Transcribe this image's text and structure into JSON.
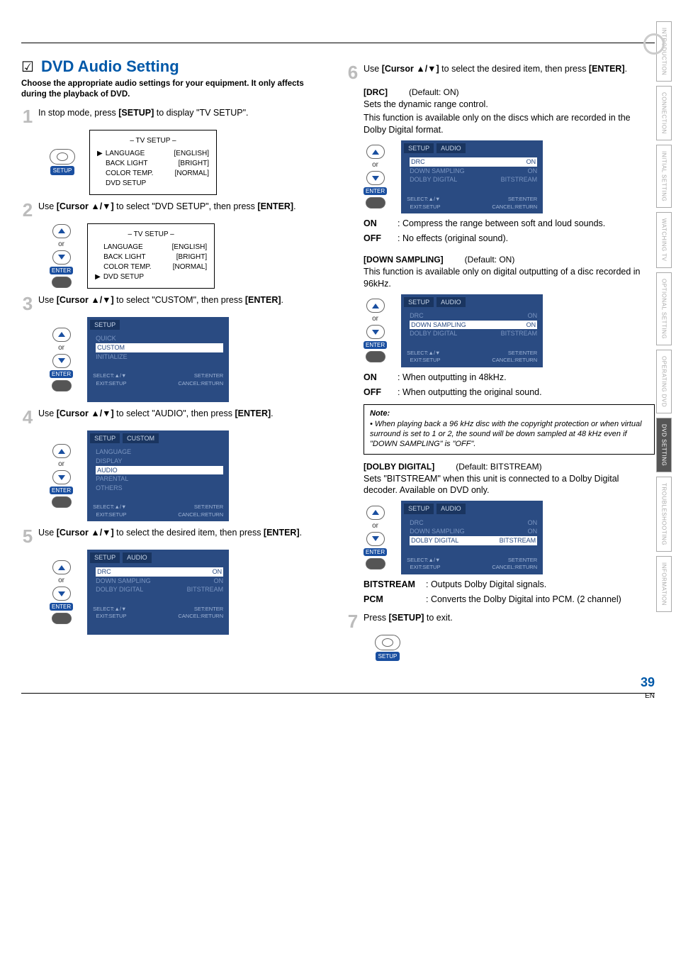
{
  "side_tabs": [
    "INTRODUCTION",
    "CONNECTION",
    "INITIAL SETTING",
    "WATCHING TV",
    "OPTIONAL SETTING",
    "OPERATING DVD",
    "DVD SETTING",
    "TROUBLESHOOTING",
    "INFORMATION"
  ],
  "active_tab_index": 6,
  "section": {
    "checkbox": "☑",
    "title": "DVD Audio Setting",
    "subtitle": "Choose the appropriate audio settings for your equipment. It only affects during the playback of DVD."
  },
  "steps": {
    "s1": {
      "num": "1",
      "pre": "In stop mode, press ",
      "bold": "[SETUP]",
      "post": " to display \"TV SETUP\"."
    },
    "s2": {
      "num": "2",
      "pre": "Use ",
      "bold": "[Cursor ▲/▼]",
      "post": " to select \"DVD SETUP\", then press ",
      "bold2": "[ENTER]",
      "post2": "."
    },
    "s3": {
      "num": "3",
      "pre": "Use ",
      "bold": "[Cursor ▲/▼]",
      "post": " to select \"CUSTOM\", then press ",
      "bold2": "[ENTER]",
      "post2": "."
    },
    "s4": {
      "num": "4",
      "pre": "Use ",
      "bold": "[Cursor ▲/▼]",
      "post": " to select \"AUDIO\", then press ",
      "bold2": "[ENTER]",
      "post2": "."
    },
    "s5": {
      "num": "5",
      "pre": "Use ",
      "bold": "[Cursor ▲/▼]",
      "post": " to select the desired item, then press ",
      "bold2": "[ENTER]",
      "post2": "."
    },
    "s6": {
      "num": "6",
      "pre": "Use ",
      "bold": "[Cursor ▲/▼]",
      "post": " to select the desired item, then press ",
      "bold2": "[ENTER]",
      "post2": "."
    },
    "s7": {
      "num": "7",
      "pre": "Press ",
      "bold": "[SETUP]",
      "post": " to exit."
    }
  },
  "labels": {
    "or": "or",
    "enter": "ENTER",
    "setup": "SETUP"
  },
  "tv_setup": {
    "title": "– TV SETUP –",
    "rows": [
      {
        "k": "LANGUAGE",
        "v": "[ENGLISH]"
      },
      {
        "k": "BACK LIGHT",
        "v": "[BRIGHT]"
      },
      {
        "k": "COLOR TEMP.",
        "v": "[NORMAL]"
      },
      {
        "k": "DVD SETUP",
        "v": ""
      }
    ],
    "ptr_index_a": 0,
    "ptr_index_b": 3
  },
  "osd_setup_menu": {
    "hdr": [
      "SETUP"
    ],
    "items": [
      "QUICK",
      "CUSTOM",
      "INITIALIZE"
    ],
    "hl_index": 1,
    "foot_l": "SELECT:▲/▼\nEXIT:SETUP",
    "foot_r": "SET:ENTER\nCANCEL:RETURN"
  },
  "osd_custom_menu": {
    "hdr": [
      "SETUP",
      "CUSTOM"
    ],
    "items": [
      "LANGUAGE",
      "DISPLAY",
      "AUDIO",
      "PARENTAL",
      "OTHERS"
    ],
    "hl_index": 2,
    "foot_l": "SELECT:▲/▼\nEXIT:SETUP",
    "foot_r": "SET:ENTER\nCANCEL:RETURN"
  },
  "osd_audio_menu": {
    "hdr": [
      "SETUP",
      "AUDIO"
    ],
    "rows": [
      {
        "k": "DRC",
        "v": "ON"
      },
      {
        "k": "DOWN SAMPLING",
        "v": "ON"
      },
      {
        "k": "DOLBY DIGITAL",
        "v": "BITSTREAM"
      }
    ],
    "foot_l": "SELECT:▲/▼\nEXIT:SETUP",
    "foot_r": "SET:ENTER\nCANCEL:RETURN"
  },
  "drc": {
    "head": "[DRC]",
    "def": "(Default: ON)",
    "p1": "Sets the dynamic range control.",
    "p2": "This function is available only on the discs which are recorded in the Dolby Digital format.",
    "hl_index": 0,
    "on": {
      "lbl": "ON",
      "txt": ": Compress the range between soft and loud sounds."
    },
    "off": {
      "lbl": "OFF",
      "txt": ": No effects (original sound)."
    }
  },
  "down": {
    "head": "[DOWN SAMPLING]",
    "def": "(Default: ON)",
    "p1": "This function is available only on digital outputting of a disc recorded in 96kHz.",
    "hl_index": 1,
    "on": {
      "lbl": "ON",
      "txt": ": When outputting in 48kHz."
    },
    "off": {
      "lbl": "OFF",
      "txt": ": When outputting the original sound."
    }
  },
  "note": {
    "title": "Note:",
    "text": "• When playing back a 96 kHz disc with the copyright protection or when virtual surround is set to 1 or 2, the sound will be down sampled at 48 kHz even if \"DOWN SAMPLING\" is \"OFF\"."
  },
  "dolby": {
    "head": "[DOLBY DIGITAL]",
    "def": "(Default: BITSTREAM)",
    "p1": "Sets \"BITSTREAM\" when this unit is connected to a Dolby Digital decoder. Available on DVD only.",
    "hl_index": 2,
    "bit": {
      "lbl": "BITSTREAM",
      "txt": ": Outputs Dolby Digital signals."
    },
    "pcm": {
      "lbl": "PCM",
      "txt": ": Converts the Dolby Digital into PCM. (2 channel)"
    }
  },
  "page_number": "39",
  "page_lang": "EN"
}
